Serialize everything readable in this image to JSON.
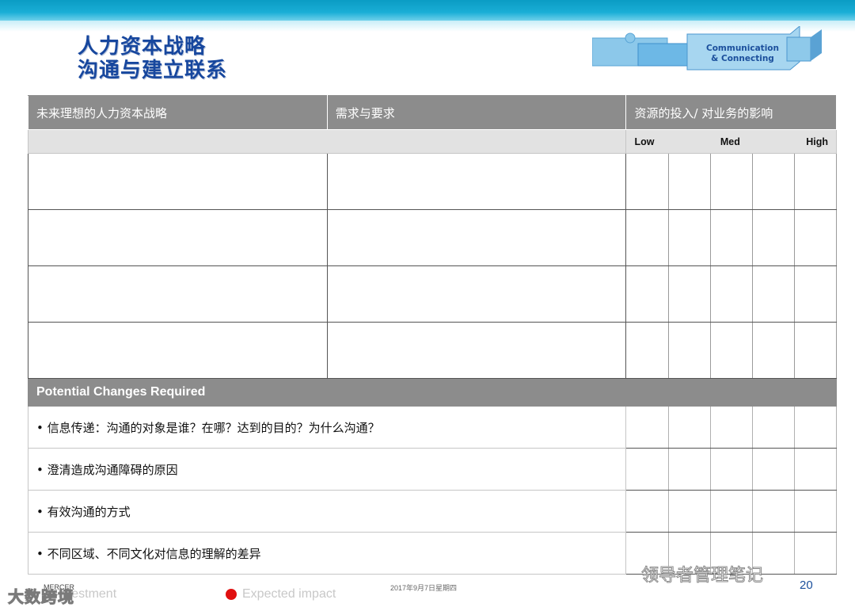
{
  "title": {
    "line1": "人力资本战略",
    "line2": "沟通与建立联系"
  },
  "logo": {
    "line1": "Communication",
    "line2": "& Connecting"
  },
  "table": {
    "headers": [
      "未来理想的人力资本战略",
      "需求与要求",
      "资源的投入/ 对业务的影响"
    ],
    "scale": [
      "Low",
      "Med",
      "High"
    ],
    "section": "Potential Changes Required",
    "changes": [
      "• 信息传递：沟通的对象是谁？在哪？达到的目的？为什么沟通？",
      "• 澄清造成沟通障碍的原因",
      "• 有效沟通的方式",
      "• 不同区域、不同文化对信息的理解的差异"
    ]
  },
  "footer": {
    "brand": "MERCER",
    "legend1": "f Investment",
    "legend2": "Expected impact",
    "date": "2017年9月7日星期四",
    "page": "20",
    "watermark_left": "大数跨境",
    "watermark_right": "领导者管理笔记",
    "legend_colors": {
      "impact": "#e01010"
    }
  }
}
